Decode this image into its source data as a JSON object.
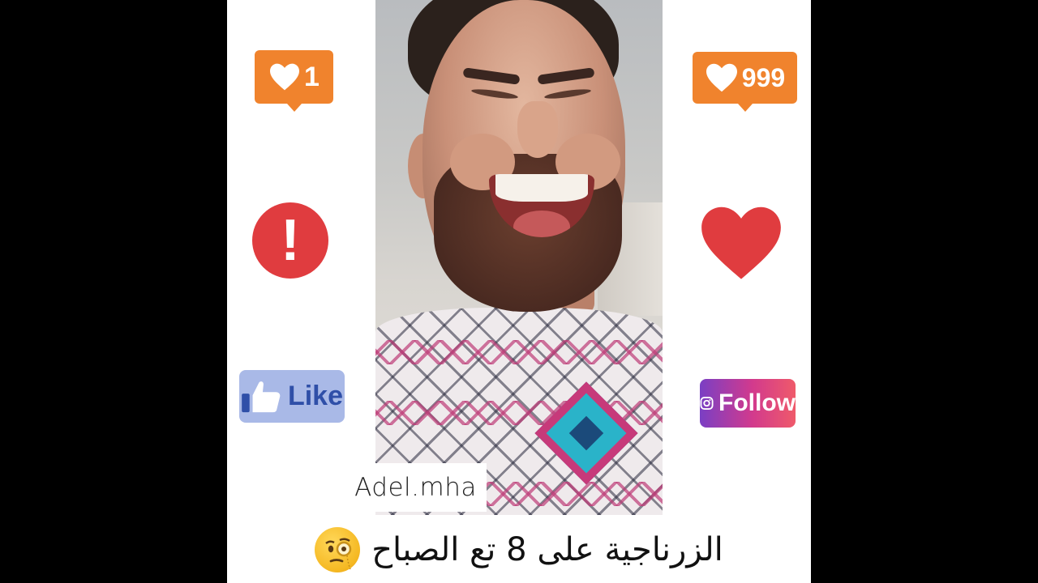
{
  "watermark": "Adel.mha",
  "caption": "الزرناجية على 8 تع الصباح",
  "caption_emoji": "face-with-monocle",
  "stickers": {
    "like_count_left": "1",
    "like_count_right": "999",
    "exclamation": "!",
    "like_label": "Like",
    "follow_label": "Follow"
  },
  "colors": {
    "background": "#000000",
    "frame": "#ffffff",
    "notification_orange": "#f0832d",
    "alert_red": "#e03c3f",
    "heart_red": "#e03c3f",
    "like_blue": "#2f4fa8"
  },
  "icons": [
    "heart-icon",
    "exclamation-icon",
    "thumbs-up-icon",
    "instagram-icon",
    "monocle-emoji-icon"
  ]
}
